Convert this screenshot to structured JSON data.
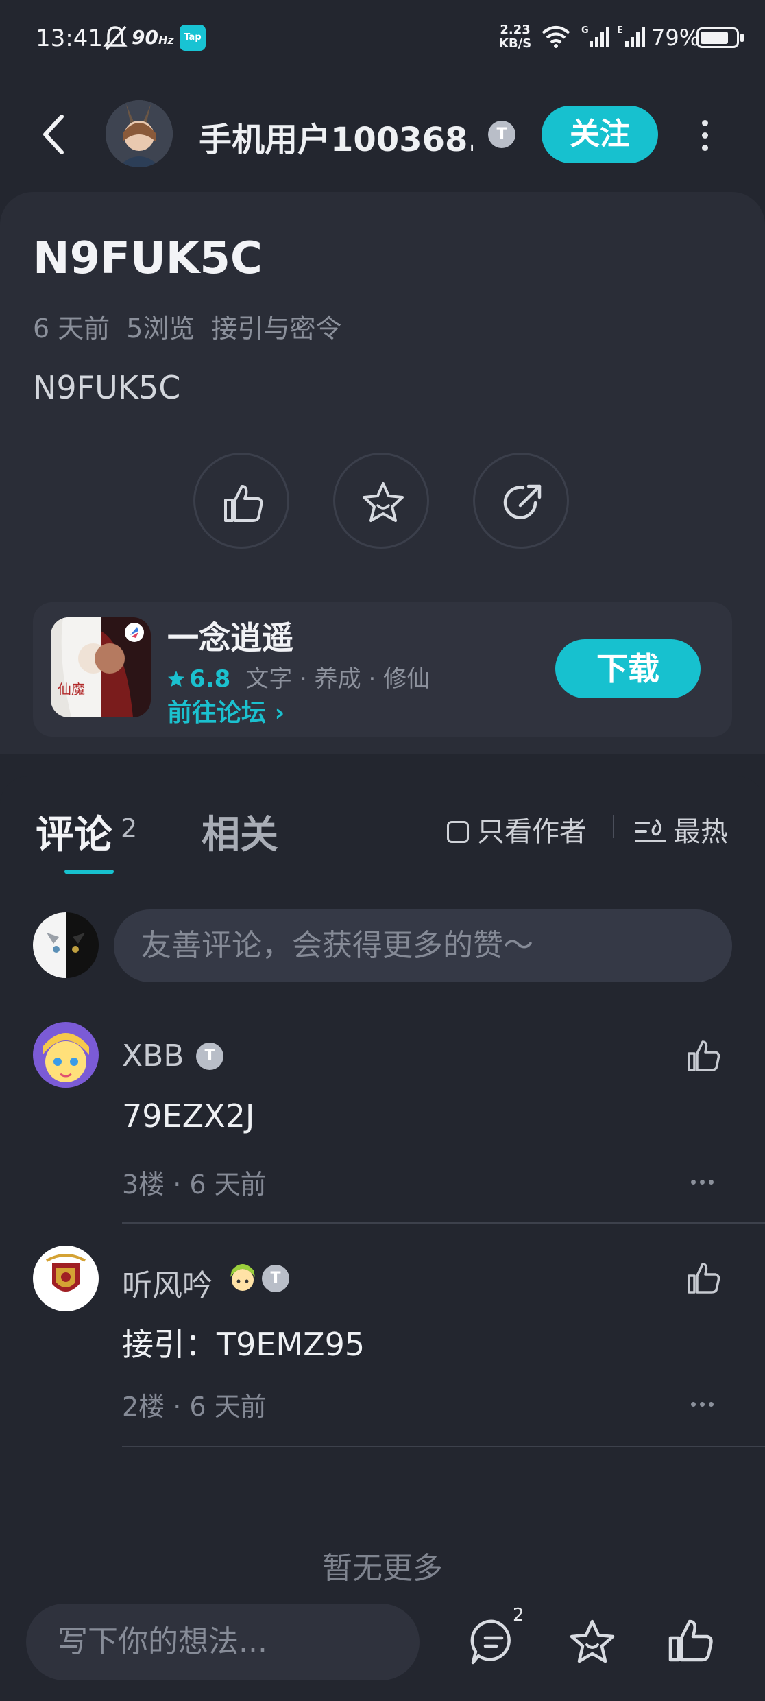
{
  "status_bar": {
    "time": "13:41",
    "refresh_rate": "90",
    "refresh_unit": "Hz",
    "tap_label": "Tap",
    "speed_value": "2.23",
    "speed_unit": "KB/S",
    "signal1_label": "G",
    "signal2_label": "E",
    "battery": "79%",
    "battery_level": 0.79
  },
  "header": {
    "author_name": "手机用户100368...",
    "level_badge": "T",
    "follow_label": "关注"
  },
  "post": {
    "title": "N9FUK5C",
    "meta": {
      "time_ago": "6 天前",
      "views": "5浏览",
      "category": "接引与密令"
    },
    "body": "N9FUK5C"
  },
  "game": {
    "name": "一念逍遥",
    "score": "6.8",
    "tags": "文字 · 养成 · 修仙",
    "forum_link": "前往论坛 ›",
    "download_label": "下载",
    "icon_text_left": "仙魔"
  },
  "comments_section": {
    "tab_comments": "评论",
    "comments_count": "2",
    "tab_related": "相关",
    "author_only": "只看作者",
    "sort_label": "最热",
    "input_placeholder": "友善评论，会获得更多的赞～",
    "items": [
      {
        "user": "XBB",
        "badge": "T",
        "text": "79EZX2J",
        "meta": "3楼 · 6 天前"
      },
      {
        "user": "听风吟",
        "badge": "T",
        "text": "接引：T9EMZ95",
        "meta": "2楼 · 6 天前"
      }
    ],
    "no_more": "暂无更多"
  },
  "bottom_bar": {
    "placeholder": "写下你的想法...",
    "comment_badge": "2"
  },
  "colors": {
    "accent": "#17c1cf",
    "background": "#23262f",
    "card": "#2a2d37"
  }
}
